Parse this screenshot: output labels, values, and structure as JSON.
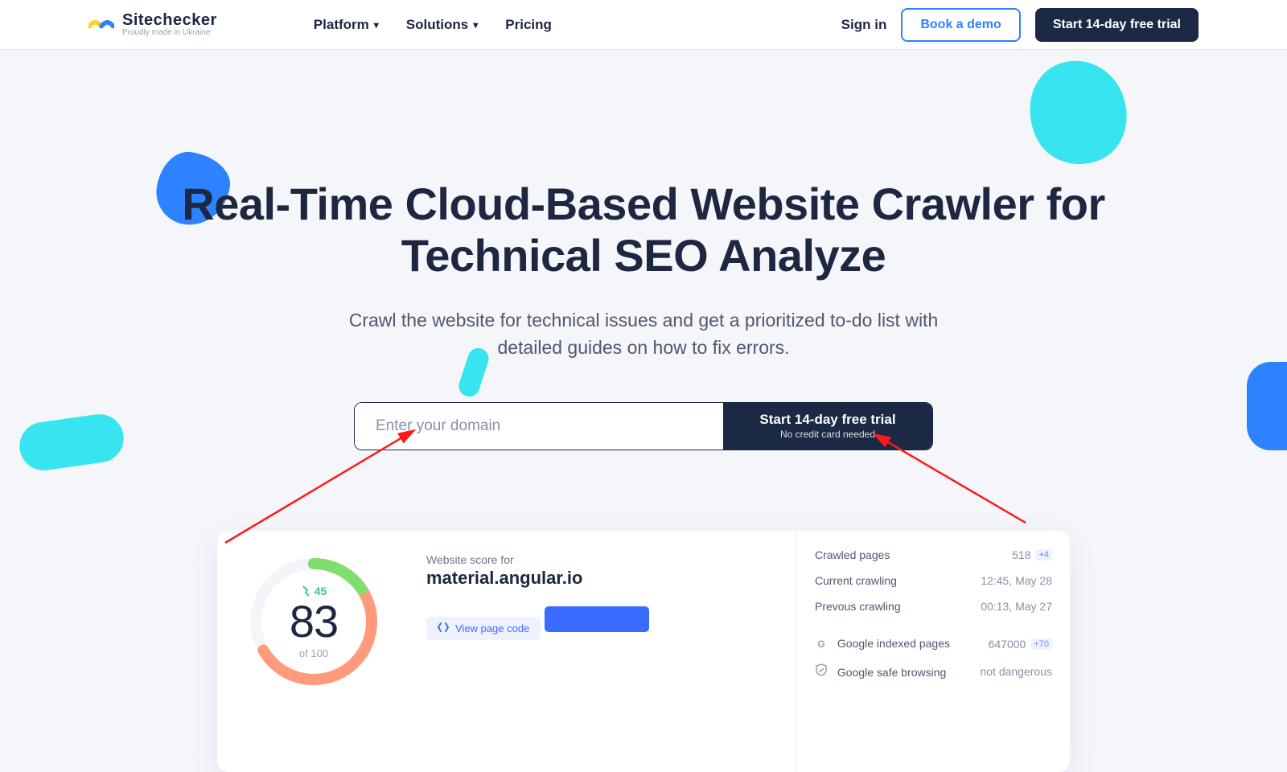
{
  "brand": {
    "name": "Sitechecker",
    "tagline": "Proudly made in Ukraine"
  },
  "nav": {
    "platform": "Platform",
    "solutions": "Solutions",
    "pricing": "Pricing",
    "signin": "Sign in",
    "book_demo": "Book a demo",
    "trial": "Start 14-day free trial"
  },
  "hero": {
    "title_line1": "Real-Time Cloud-Based Website Crawler for",
    "title_line2": "Technical SEO Analyze",
    "subtitle_line1": "Crawl the website for technical issues and get a prioritized to-do list with",
    "subtitle_line2": "detailed guides on how to fix errors.",
    "input_placeholder": "Enter your domain",
    "cta_main": "Start 14-day free trial",
    "cta_sub": "No credit card needed"
  },
  "preview": {
    "score": "83",
    "of": "of 100",
    "delta": "45",
    "ws_for": "Website score for",
    "ws_domain": "material.angular.io",
    "view_code": "View page code",
    "stats": {
      "crawled_label": "Crawled pages",
      "crawled_val": "518",
      "crawled_plus": "+4",
      "current_label": "Current crawling",
      "current_val": "12:45, May 28",
      "prev_label": "Prevous crawling",
      "prev_val": "00:13, May 27",
      "indexed_label": "Google indexed pages",
      "indexed_val": "647000",
      "indexed_plus": "+70",
      "safe_label": "Google safe browsing",
      "safe_val": "not dangerous"
    }
  }
}
